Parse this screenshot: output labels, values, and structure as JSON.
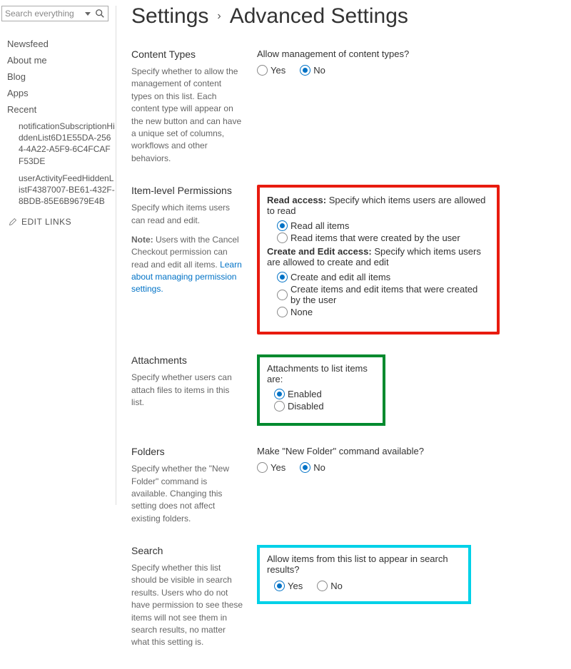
{
  "search": {
    "placeholder": "Search everything"
  },
  "nav": {
    "items": [
      "Newsfeed",
      "About me",
      "Blog",
      "Apps",
      "Recent"
    ],
    "recent": [
      "notificationSubscriptionHiddenList6D1E55DA-2564-4A22-A5F9-6C4FCAFF53DE",
      "userActivityFeedHiddenListF4387007-BE61-432F-8BDB-85E6B9679E4B"
    ],
    "edit": "EDIT LINKS"
  },
  "breadcrumb": {
    "root": "Settings",
    "current": "Advanced Settings"
  },
  "contentTypes": {
    "heading": "Content Types",
    "desc": "Specify whether to allow the management of content types on this list. Each content type will appear on the new button and can have a unique set of columns, workflows and other behaviors.",
    "question": "Allow management of content types?",
    "yes": "Yes",
    "no": "No"
  },
  "permissions": {
    "heading": "Item-level Permissions",
    "desc": "Specify which items users can read and edit.",
    "note_label": "Note:",
    "note_text": " Users with the Cancel Checkout permission can read and edit all items. ",
    "note_link": "Learn about managing permission settings.",
    "read_head": "Read access:",
    "read_desc": "  Specify which items users are allowed to read",
    "read_all": "Read all items",
    "read_own": "Read items that were created by the user",
    "create_head": "Create and Edit access:",
    "create_desc": "  Specify which items users are allowed to create and edit",
    "create_all": "Create and edit all items",
    "create_own": "Create items and edit items that were created by the user",
    "none": "None"
  },
  "attachments": {
    "heading": "Attachments",
    "desc": "Specify whether users can attach files to items in this list.",
    "question": "Attachments to list items are:",
    "enabled": "Enabled",
    "disabled": "Disabled"
  },
  "folders": {
    "heading": "Folders",
    "desc": "Specify whether the \"New Folder\" command is available. Changing this setting does not affect existing folders.",
    "question": "Make \"New Folder\" command available?",
    "yes": "Yes",
    "no": "No"
  },
  "searchSection": {
    "heading": "Search",
    "desc": "Specify whether this list should be visible in search results. Users who do not have permission to see these items will not see them in search results, no matter what this setting is.",
    "question": "Allow items from this list to appear in search results?",
    "yes": "Yes",
    "no": "No"
  }
}
